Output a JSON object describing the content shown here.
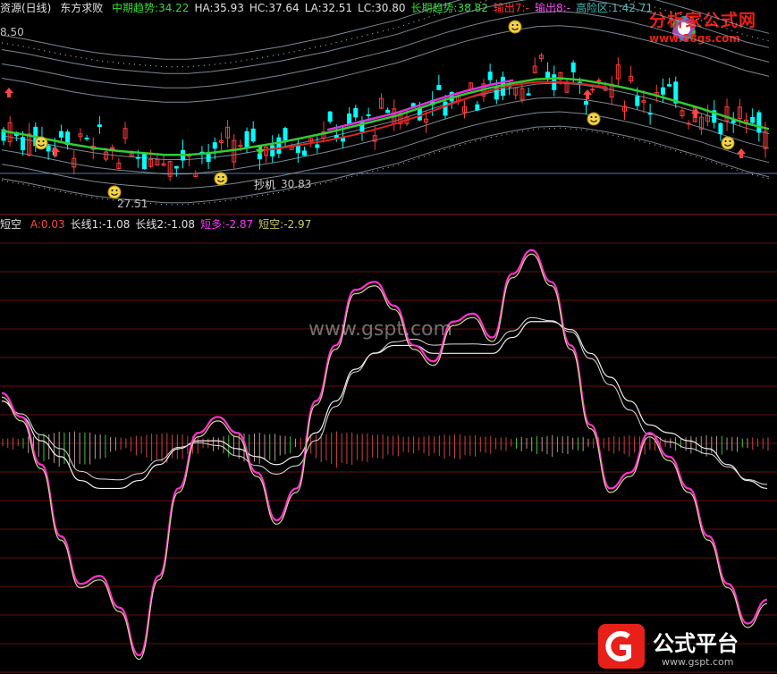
{
  "header": {
    "title": "资源(日线)",
    "subtitle": "东方求败",
    "items": [
      {
        "label": "中期趋势:34.22",
        "color": "#33dd33"
      },
      {
        "label": "HA:35.93",
        "color": "#e0e0e0"
      },
      {
        "label": "HC:37.64",
        "color": "#e0e0e0"
      },
      {
        "label": "LA:32.51",
        "color": "#e0e0e0"
      },
      {
        "label": "LC:30.80",
        "color": "#e0e0e0"
      },
      {
        "label": "长期趋势:38.82",
        "color": "#33dd33"
      },
      {
        "label": "输出7:-",
        "color": "#ff3333"
      },
      {
        "label": "输出8:-",
        "color": "#ff44ff"
      },
      {
        "label": "高险区:1:42.71",
        "color": "#44bbbb"
      }
    ]
  },
  "indicator_header": {
    "title": "短空",
    "items": [
      {
        "label": "A:0.03",
        "color": "#ff4444"
      },
      {
        "label": "长线1:-1.08",
        "color": "#e0e0e0"
      },
      {
        "label": "长线2:-1.08",
        "color": "#e0e0e0"
      },
      {
        "label": "短多:-2.87",
        "color": "#ff33ff"
      },
      {
        "label": "短空:-2.97",
        "color": "#cccc66"
      }
    ]
  },
  "price_panel": {
    "top_price_label": "8.50",
    "annotations": {
      "low_label": "27.51",
      "buy_label": "抄机",
      "buy_value": "30.83"
    }
  },
  "watermark": "www.gspt.com",
  "brand_top": {
    "text": "分析家公式网",
    "url": "www.88gs.com"
  },
  "brand_bottom": {
    "text": "公式平台",
    "url": "www.gspt.com"
  },
  "colors": {
    "mid_trend": "#33cc33",
    "long_trend": "#dd2222",
    "magenta_line": "#dd33dd",
    "band": "#9aa9b8",
    "up_candle": "#ff3b3b",
    "down_candle": "#00ffff",
    "white_line": "#f0f0f0",
    "pink_line": "#ff33cc",
    "yellow_line": "#d6d68c"
  },
  "chart_data": [
    {
      "type": "line",
      "title": "",
      "series": [
        {
          "name": "中期趋势",
          "values": [
            34.0,
            33.6,
            33.1,
            32.6,
            32.2,
            31.9,
            31.7,
            31.5,
            31.5,
            31.7,
            32.0,
            32.4,
            32.8,
            33.3,
            33.8,
            34.4,
            35.0,
            35.6,
            36.4,
            37.2,
            37.9,
            38.5,
            39.0,
            39.4,
            39.5,
            39.3,
            38.9,
            38.4,
            37.8,
            37.1,
            36.4,
            35.6,
            34.8,
            34.2
          ]
        },
        {
          "name": "长期趋势",
          "values": [
            null,
            null,
            null,
            null,
            null,
            null,
            null,
            null,
            null,
            null,
            null,
            31.9,
            32.2,
            32.6,
            33.0,
            33.5,
            34.1,
            34.8,
            35.6,
            36.5,
            37.4,
            38.2,
            38.8,
            39.1,
            39.1,
            38.9,
            38.6,
            null,
            null,
            null,
            null,
            null,
            null,
            null
          ]
        }
      ]
    },
    {
      "type": "line",
      "title": "",
      "series": [
        {
          "name": "短多",
          "values": [
            3.0,
            1.5,
            -1.5,
            -6.0,
            -9.0,
            -8.5,
            -10.5,
            -13.5,
            -8.5,
            -3.0,
            0.5,
            1.5,
            0.5,
            -2.0,
            -5.0,
            -3.0,
            2.5,
            6.0,
            9.5,
            10.0,
            8.5,
            6.0,
            5.0,
            7.5,
            8.0,
            6.5,
            10.5,
            12.0,
            10.0,
            6.0,
            1.0,
            -3.0,
            -2.0,
            0.5,
            -1.0,
            -3.0,
            -6.0,
            -9.0,
            -11.5,
            -10.0
          ]
        },
        {
          "name": "长线1",
          "values": [
            2.5,
            1.5,
            0.0,
            -1.0,
            -2.5,
            -3.0,
            -3.0,
            -2.5,
            -1.5,
            -0.5,
            0.0,
            0.0,
            -0.5,
            -1.0,
            -1.5,
            -1.0,
            0.5,
            2.5,
            4.5,
            5.5,
            6.0,
            6.0,
            5.5,
            5.5,
            5.5,
            5.5,
            6.5,
            7.5,
            7.5,
            7.0,
            5.5,
            4.0,
            2.5,
            1.0,
            0.5,
            0.0,
            -0.5,
            -1.5,
            -2.5,
            -3.0
          ]
        },
        {
          "name": "A",
          "values": [
            0.0,
            0.0,
            -0.3,
            -0.5,
            -0.5,
            -0.3,
            0.0,
            0.2,
            0.4,
            0.3,
            0.1,
            -0.1,
            -0.3,
            -0.4,
            -0.3,
            0.0,
            0.3,
            0.5,
            0.4,
            0.3,
            0.2,
            0.1,
            0.2,
            0.3,
            0.2,
            0.1,
            0.0,
            -0.1,
            -0.2,
            -0.1,
            0.0,
            0.1,
            0.2,
            0.1,
            0.0,
            -0.1,
            -0.2,
            -0.1,
            0.0,
            0.03
          ]
        }
      ]
    }
  ]
}
